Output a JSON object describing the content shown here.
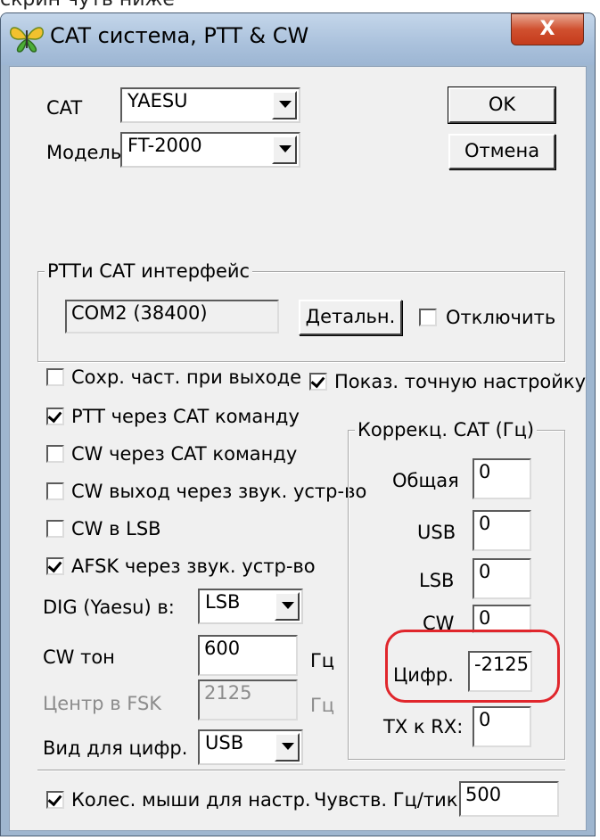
{
  "top_crop_text": "скрин чуть ниже",
  "window": {
    "title": "CAT система, PTT & CW",
    "close_label": "X"
  },
  "cat": {
    "label": "CAT",
    "value": "YAESU",
    "model_label": "Модель",
    "model_value": "FT-2000"
  },
  "buttons": {
    "ok": "OK",
    "cancel": "Отмена"
  },
  "interface_group": {
    "title": "PTTи CAT интерфейс",
    "port_value": "COM2 (38400)",
    "details_button": "Детальн.",
    "disable_label": "Отключить",
    "disable_checked": false
  },
  "options": [
    {
      "label": "Сохр. част. при выходе",
      "checked": false
    },
    {
      "label": "Показ. точную настройку",
      "checked": true
    },
    {
      "label": "PTT через CAT команду",
      "checked": true
    },
    {
      "label": "CW через CAT команду",
      "checked": false
    },
    {
      "label": "CW выход через звук. устр-во",
      "checked": false
    },
    {
      "label": "CW в LSB",
      "checked": false
    },
    {
      "label": "AFSK через звук. устр-во",
      "checked": true
    }
  ],
  "dig_mode": {
    "label": "DIG (Yaesu) в:",
    "value": "LSB"
  },
  "cw_tone": {
    "label": "CW тон",
    "value": "600",
    "unit": "Гц"
  },
  "fsk_center": {
    "label": "Центр в FSK",
    "value": "2125",
    "unit": "Гц"
  },
  "digital_mode": {
    "label": "Вид для цифр.",
    "value": "USB"
  },
  "correction_group": {
    "title": "Коррекц. CAT (Гц)",
    "rows": [
      {
        "label": "Общая",
        "value": "0"
      },
      {
        "label": "USB",
        "value": "0"
      },
      {
        "label": "LSB",
        "value": "0"
      },
      {
        "label": "CW",
        "value": "0"
      },
      {
        "label": "Цифр.",
        "value": "-2125"
      },
      {
        "label": "TX к RX:",
        "value": "0"
      }
    ]
  },
  "mouse_wheel": {
    "label": "Колес. мыши для настр.",
    "checked": true
  },
  "sensitivity": {
    "label": "Чувств. Гц/тик",
    "value": "500"
  },
  "colors": {
    "highlight": "#e0262c",
    "dialog_bg": "#f0f0f0",
    "titlebar": "#aac1dc",
    "close_button": "#d0502f"
  }
}
